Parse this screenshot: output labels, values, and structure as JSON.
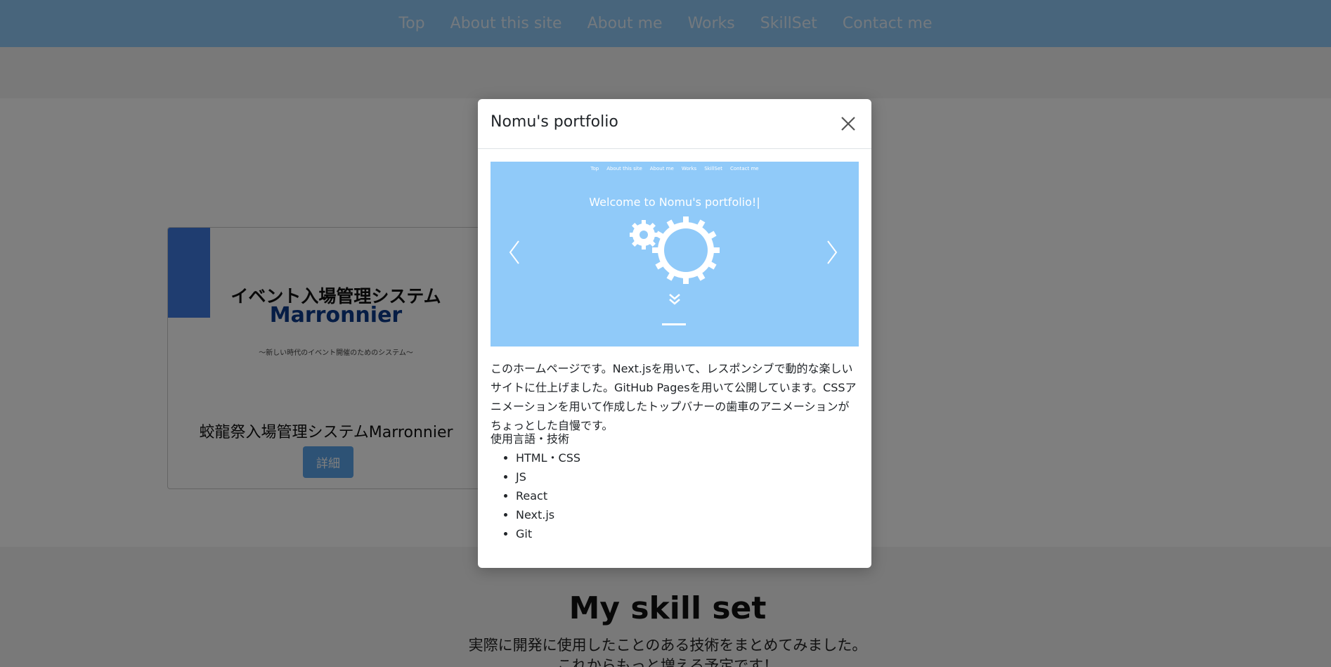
{
  "navbar": {
    "items": [
      {
        "label": "Top"
      },
      {
        "label": "About this site"
      },
      {
        "label": "About me"
      },
      {
        "label": "Works"
      },
      {
        "label": "SkillSet"
      },
      {
        "label": "Contact me"
      }
    ]
  },
  "works": {
    "card": {
      "thumb_title": "イベント入場管理システム",
      "thumb_brand": "Marronnier",
      "thumb_subtitle": "〜新しい時代のイベント開催のためのシステム〜",
      "title": "蛟龍祭入場管理システムMarronnier",
      "button": "詳細"
    }
  },
  "skills": {
    "title": "My skill set",
    "desc_line1": "実際に開発に使用したことのある技術をまとめてみました。",
    "desc_line2": "これからもっと増える予定です！"
  },
  "modal": {
    "title": "Nomu's portfolio",
    "carousel": {
      "nav": [
        "Top",
        "About this site",
        "About me",
        "Works",
        "SkillSet",
        "Contact me"
      ],
      "caption": "Welcome to Nomu's portfolio!|"
    },
    "description": "このホームページです。Next.jsを用いて、レスポンシブで動的な楽しいサイトに仕上げました。GitHub Pagesを用いて公開しています。CSSアニメーションを用いて作成したトップバナーの歯車のアニメーションがちょっとした自慢です。",
    "tech_heading": "使用言語・技術",
    "tech": [
      "HTML・CSS",
      "JS",
      "React",
      "Next.js",
      "Git"
    ]
  },
  "colors": {
    "navbar": "#90caf9",
    "accent": "#3f7be0",
    "button": "#5ba4ea"
  }
}
